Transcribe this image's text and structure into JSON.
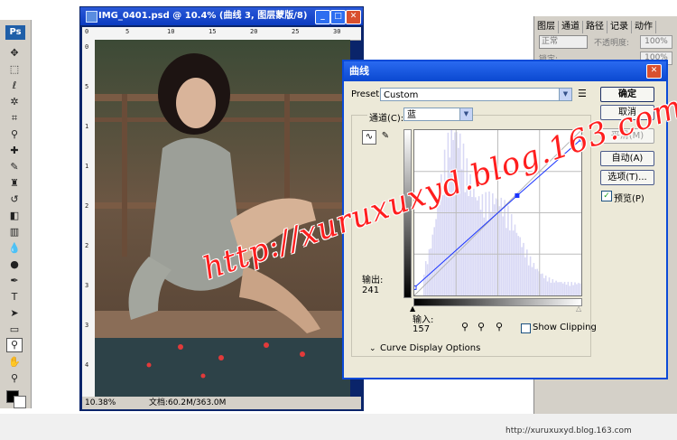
{
  "app": {
    "logo": "Ps"
  },
  "document": {
    "title": "IMG_0401.psd @ 10.4% (曲线 3, 图层蒙版/8)",
    "zoom": "10.38%",
    "doc_size": "文档:60.2M/363.0M",
    "ruler_top": [
      "0",
      "5",
      "10",
      "15",
      "20",
      "25",
      "30"
    ],
    "ruler_left": [
      "0",
      "5",
      "1",
      "1",
      "2",
      "2",
      "3",
      "3",
      "4"
    ]
  },
  "layers_panel": {
    "tabs": [
      "图层",
      "通道",
      "路径",
      "记录",
      "动作"
    ],
    "blend_mode": "正常",
    "opacity_label": "不透明度:",
    "opacity_value": "100%",
    "lock_label": "锁定:",
    "fill_value": "100%"
  },
  "curves": {
    "title": "曲线",
    "preset_label": "Preset:",
    "preset_value": "Custom",
    "channel_label": "通道(C):",
    "channel_value": "蓝",
    "output_label": "输出:",
    "output_value": "241",
    "input_label": "输入:",
    "input_value": "157",
    "show_clipping": "Show Clipping",
    "curve_display": "Curve Display Options",
    "buttons": {
      "ok": "确定",
      "cancel": "取消",
      "smooth": "平滑(M)",
      "auto": "自动(A)",
      "options": "选项(T)..."
    },
    "preview_label": "预览(P)",
    "preview_checked": true,
    "curve_points": {
      "input_output": [
        [
          0,
          12
        ],
        [
          157,
          154
        ],
        [
          255,
          241
        ]
      ]
    }
  },
  "watermark": "http://xuruxuxyd.blog.163.com",
  "footer_url": "http://xuruxuxyd.blog.163.com",
  "colors": {
    "title_blue": "#0a48d0",
    "watermark": "#ff1e1e"
  }
}
